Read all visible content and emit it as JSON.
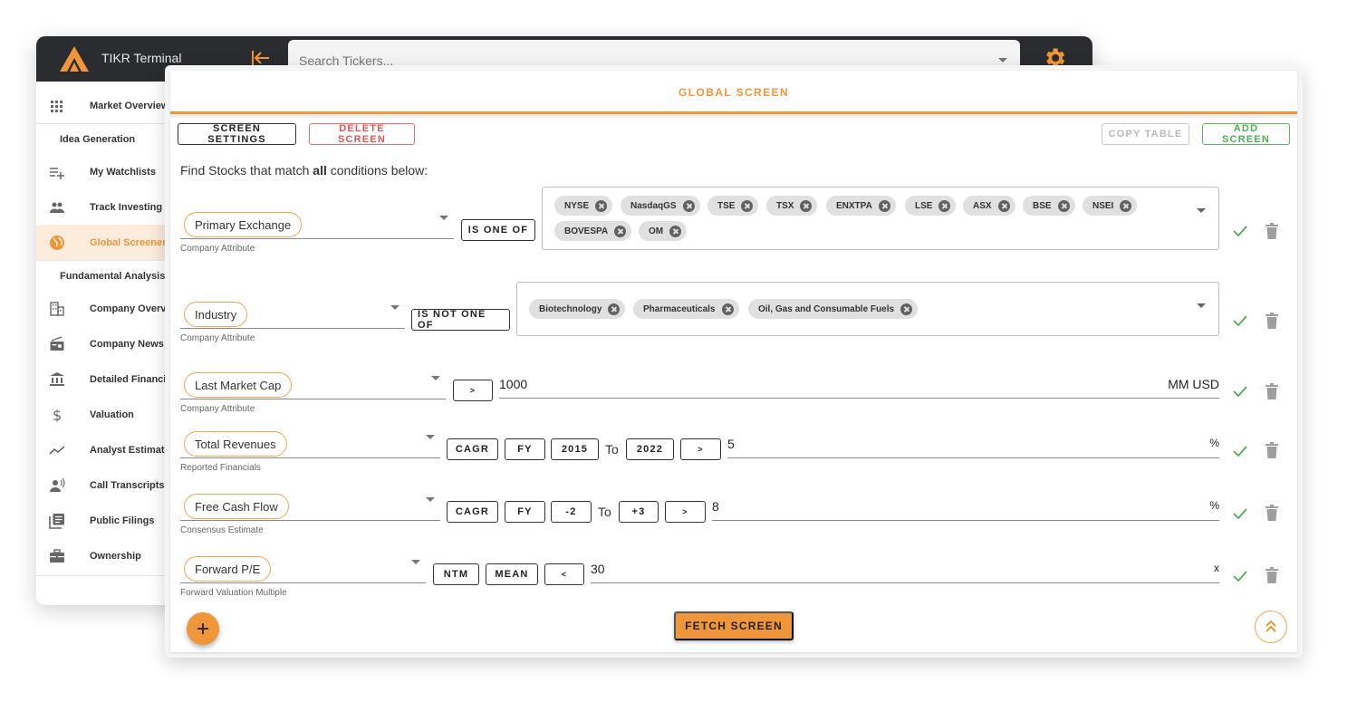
{
  "app": {
    "title": "TIKR Terminal",
    "search_placeholder": "Search Tickers...",
    "accent_color": "#f0963a"
  },
  "sidebar": {
    "items": [
      {
        "label": "Market Overview",
        "icon": "grid-icon"
      },
      {
        "section": "Idea Generation"
      },
      {
        "label": "My Watchlists",
        "icon": "playlist-add-icon"
      },
      {
        "label": "Track Investing G",
        "icon": "people-icon"
      },
      {
        "label": "Global Screener",
        "icon": "globe-icon",
        "active": true
      },
      {
        "section": "Fundamental Analysis"
      },
      {
        "label": "Company Overvie",
        "icon": "building-icon"
      },
      {
        "label": "Company News",
        "icon": "radio-icon"
      },
      {
        "label": "Detailed Financial",
        "icon": "bank-icon"
      },
      {
        "label": "Valuation",
        "icon": "dollar-icon"
      },
      {
        "label": "Analyst Estimates",
        "icon": "trending-icon"
      },
      {
        "label": "Call Transcripts",
        "icon": "speaker-person-icon"
      },
      {
        "label": "Public Filings",
        "icon": "library-books-icon"
      },
      {
        "label": "Ownership",
        "icon": "briefcase-icon"
      }
    ]
  },
  "screener": {
    "title": "GLOBAL SCREEN",
    "buttons": {
      "settings": "SCREEN SETTINGS",
      "delete": "DELETE SCREEN",
      "copy": "COPY TABLE",
      "add": "ADD SCREEN",
      "fetch": "FETCH SCREEN"
    },
    "intro_prefix": "Find Stocks that match ",
    "intro_bold": "all",
    "intro_suffix": " conditions below:",
    "conditions": [
      {
        "metric": "Primary Exchange",
        "category": "Company Attribute",
        "operator": "IS ONE OF",
        "values": [
          "NYSE",
          "NasdaqGS",
          "TSE",
          "TSX",
          "ENXTPA",
          "LSE",
          "ASX",
          "BSE",
          "NSEI",
          "BOVESPA",
          "OM"
        ]
      },
      {
        "metric": "Industry",
        "category": "Company Attribute",
        "operator": "IS NOT ONE OF",
        "values": [
          "Biotechnology",
          "Pharmaceuticals",
          "Oil, Gas and Consumable Fuels"
        ]
      },
      {
        "metric": "Last Market Cap",
        "category": "Company Attribute",
        "comparator": ">",
        "value": "1000",
        "unit": "MM USD"
      },
      {
        "metric": "Total Revenues",
        "category": "Reported Financials",
        "calc": "CAGR",
        "period": "FY",
        "from": "2015",
        "to_label": "To",
        "to": "2022",
        "comparator": ">",
        "value": "5",
        "unit": "%"
      },
      {
        "metric": "Free Cash Flow",
        "category": "Consensus Estimate",
        "calc": "CAGR",
        "period": "FY",
        "from": "-2",
        "to_label": "To",
        "to": "+3",
        "comparator": ">",
        "value": "8",
        "unit": "%"
      },
      {
        "metric": "Forward P/E",
        "category": "Forward Valuation Multiple",
        "period": "NTM",
        "stat": "MEAN",
        "comparator": "<",
        "value": "30",
        "unit": "x"
      }
    ]
  }
}
